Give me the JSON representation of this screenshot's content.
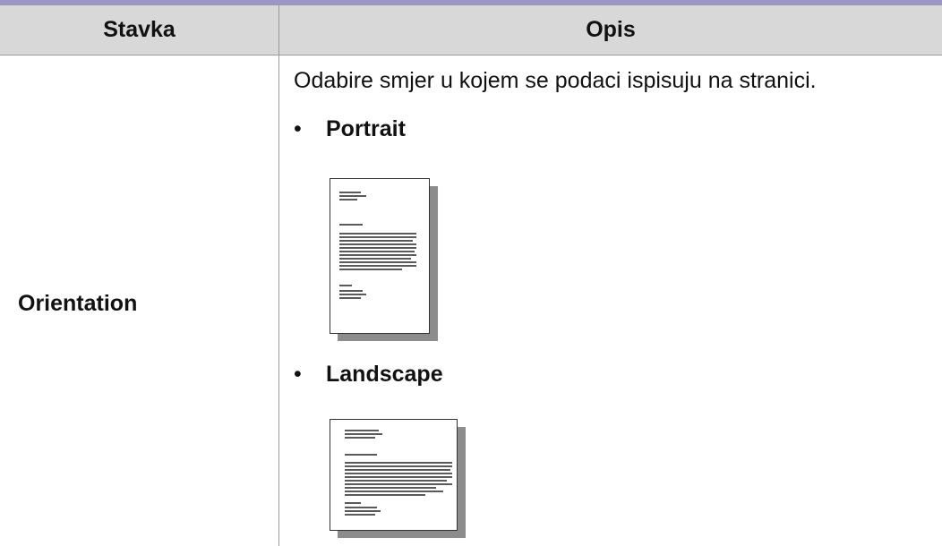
{
  "table": {
    "headers": {
      "item": "Stavka",
      "description": "Opis"
    },
    "row": {
      "label": "Orientation",
      "description": "Odabire smjer u kojem se podaci ispisuju na stranici.",
      "options": [
        {
          "bullet": "•",
          "label": "Portrait",
          "illustration": "portrait-page-icon"
        },
        {
          "bullet": "•",
          "label": "Landscape",
          "illustration": "landscape-page-icon"
        }
      ]
    }
  },
  "colors": {
    "top_rule": "#9a97c4",
    "header_background": "#d8d8d8",
    "grid_line": "#9a9a9a",
    "page_shadow": "#8c8c8c"
  }
}
